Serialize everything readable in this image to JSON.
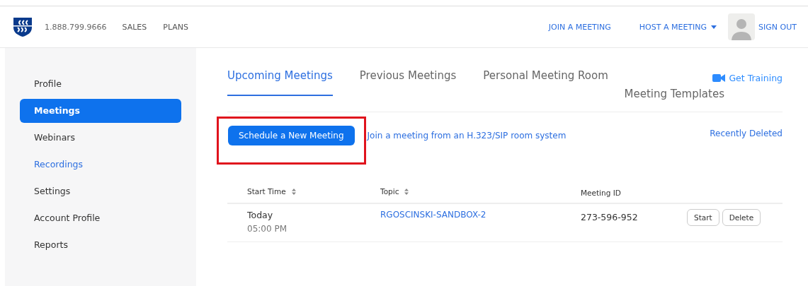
{
  "header": {
    "phone": "1.888.799.9666",
    "nav_left": [
      "SALES",
      "PLANS"
    ],
    "nav_right": [
      {
        "label": "JOIN A MEETING",
        "dropdown": false
      },
      {
        "label": "HOST A MEETING",
        "dropdown": true
      }
    ],
    "sign_out": "SIGN OUT"
  },
  "sidebar": {
    "items": [
      {
        "label": "Profile",
        "selected": false,
        "link": false
      },
      {
        "label": "Meetings",
        "selected": true,
        "link": false
      },
      {
        "label": "Webinars",
        "selected": false,
        "link": false
      },
      {
        "label": "Recordings",
        "selected": false,
        "link": true
      },
      {
        "label": "Settings",
        "selected": false,
        "link": false
      },
      {
        "label": "Account Profile",
        "selected": false,
        "link": false
      },
      {
        "label": "Reports",
        "selected": false,
        "link": false
      }
    ]
  },
  "tabs": [
    {
      "label": "Upcoming Meetings",
      "selected": true
    },
    {
      "label": "Previous Meetings",
      "selected": false
    },
    {
      "label": "Personal Meeting Room",
      "selected": false
    },
    {
      "label": "Meeting Templates",
      "selected": false
    }
  ],
  "get_training": "Get Training",
  "schedule_button": {
    "label": "Schedule a New Meeting",
    "highlighted": true
  },
  "join_link": "Join a meeting from an H.323/SIP room system",
  "recently_deleted": "Recently Deleted",
  "table": {
    "columns": [
      {
        "label": "Start Time",
        "sortable": true
      },
      {
        "label": "Topic",
        "sortable": true
      },
      {
        "label": "Meeting ID",
        "sortable": false
      }
    ],
    "rows": [
      {
        "day": "Today",
        "time": "05:00 PM",
        "topic": "RGOSCINSKI-SANDBOX-2",
        "meeting_id": "273-596-952",
        "actions": [
          "Start",
          "Delete"
        ]
      }
    ]
  }
}
